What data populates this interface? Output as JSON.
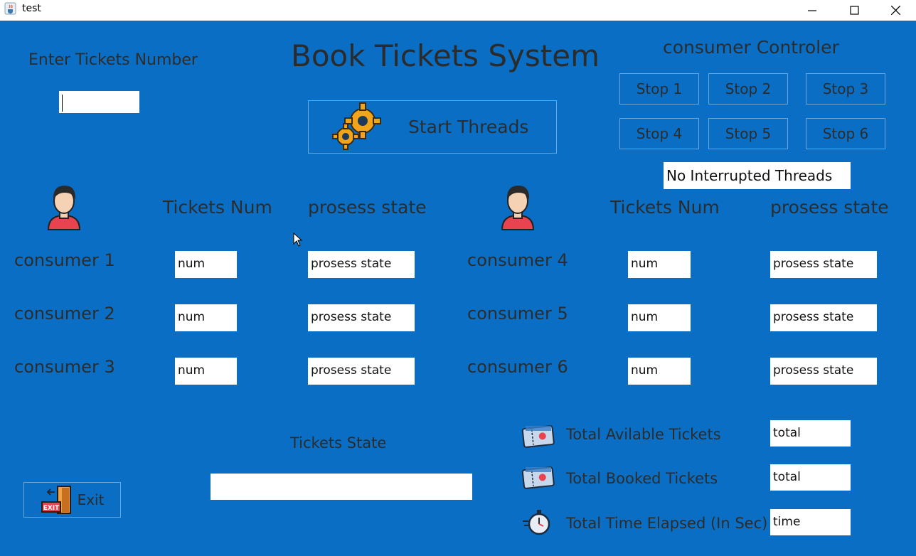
{
  "window": {
    "title": "test"
  },
  "app": {
    "title": "Book Tickets System",
    "enter_label": "Enter Tickets Number",
    "start_label": "Start Threads",
    "controller_title": "consumer Controler",
    "stop_buttons": [
      "Stop 1",
      "Stop 2",
      "Stop 3",
      "Stop 4",
      "Stop 5",
      "Stop 6"
    ],
    "interrupt_status": "No Interrupted Threads",
    "col_tickets": "Tickets Num",
    "col_state": "prosess state",
    "consumers": [
      {
        "name": "consumer 1",
        "num": "num",
        "state": "prosess state"
      },
      {
        "name": "consumer 2",
        "num": "num",
        "state": "prosess state"
      },
      {
        "name": "consumer 3",
        "num": "num",
        "state": "prosess state"
      },
      {
        "name": "consumer 4",
        "num": "num",
        "state": "prosess state"
      },
      {
        "name": "consumer 5",
        "num": "num",
        "state": "prosess state"
      },
      {
        "name": "consumer 6",
        "num": "num",
        "state": "prosess state"
      }
    ],
    "tickets_state_label": "Tickets State",
    "tickets_state_value": "",
    "available_label": "Total Avilable Tickets",
    "available_value": "total",
    "booked_label": "Total Booked Tickets",
    "booked_value": "total",
    "time_label": "Total Time Elapsed (In Sec)",
    "time_value": "time",
    "exit_label": "Exit",
    "exit_sign_text": "EXIT"
  },
  "icons": {
    "app": "java-cup-icon",
    "start": "gears-icon",
    "user": "user-avatar-icon",
    "ticket": "ticket-icon",
    "timer": "stopwatch-icon",
    "exit": "exit-door-icon"
  },
  "colors": {
    "background": "#0a6fc4",
    "field": "#ffffff",
    "gear": "#f2a51a",
    "avatar_shirt": "#e8434f"
  }
}
